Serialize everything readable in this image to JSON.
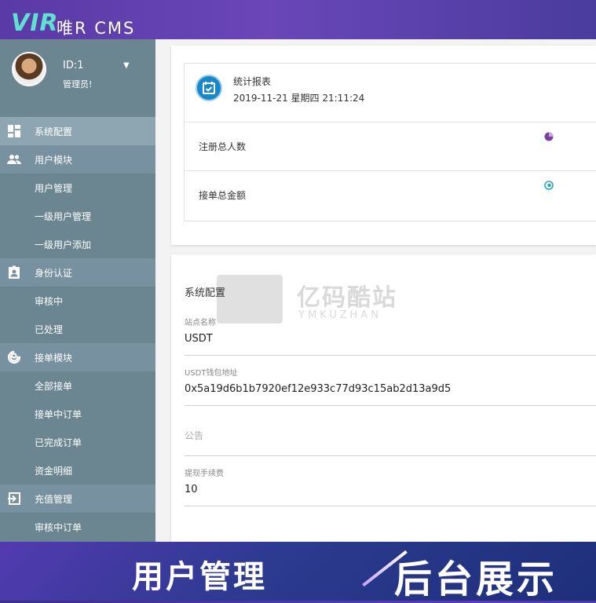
{
  "brand": {
    "logo": "VIR",
    "name": "唯R CMS"
  },
  "profile": {
    "id": "ID:1",
    "role": "管理员!"
  },
  "sidebar": {
    "items": [
      {
        "label": "系统配置",
        "icon": "dashboard-icon",
        "level": "group"
      },
      {
        "label": "用户模块",
        "icon": "people-icon",
        "level": "group"
      },
      {
        "label": "用户管理",
        "level": "child"
      },
      {
        "label": "一级用户管理",
        "level": "child"
      },
      {
        "label": "一级用户添加",
        "level": "child"
      },
      {
        "label": "身份认证",
        "icon": "id-card-icon",
        "level": "group"
      },
      {
        "label": "审核中",
        "level": "child"
      },
      {
        "label": "已处理",
        "level": "child"
      },
      {
        "label": "接单模块",
        "icon": "spiral-icon",
        "level": "group"
      },
      {
        "label": "全部接单",
        "level": "child"
      },
      {
        "label": "接单中订单",
        "level": "child"
      },
      {
        "label": "已完成订单",
        "level": "child"
      },
      {
        "label": "资金明细",
        "level": "child"
      },
      {
        "label": "充值管理",
        "icon": "login-icon",
        "level": "group"
      },
      {
        "label": "审核中订单",
        "level": "child"
      }
    ]
  },
  "stats": {
    "title": "统计报表",
    "datetime": "2019-11-21  星期四 21:11:24",
    "rows": [
      {
        "label": "注册总人数",
        "icon": "pie-icon",
        "color": "#7a3f9e"
      },
      {
        "label": "接单总金额",
        "icon": "circle-dot-icon",
        "color": "#2aa6c4"
      }
    ]
  },
  "config": {
    "title": "系统配置",
    "fields": [
      {
        "label": "站点名称",
        "value": "USDT"
      },
      {
        "label": "USDT钱包地址",
        "value": "0x5a19d6b1b7920ef12e933c77d93c15ab2d13a9d5"
      },
      {
        "label": "",
        "placeholder": "公告",
        "value": ""
      },
      {
        "label": "提现手续费",
        "value": "10"
      }
    ]
  },
  "watermark": {
    "cn": "亿码酷站",
    "en": "YMKUZHAN"
  },
  "banner": {
    "left": "用户管理",
    "right": "后台展示"
  },
  "colors": {
    "sidebar": "#6b8691",
    "accent": "#1a87c9",
    "brand_teal": "#5fe0d3"
  }
}
